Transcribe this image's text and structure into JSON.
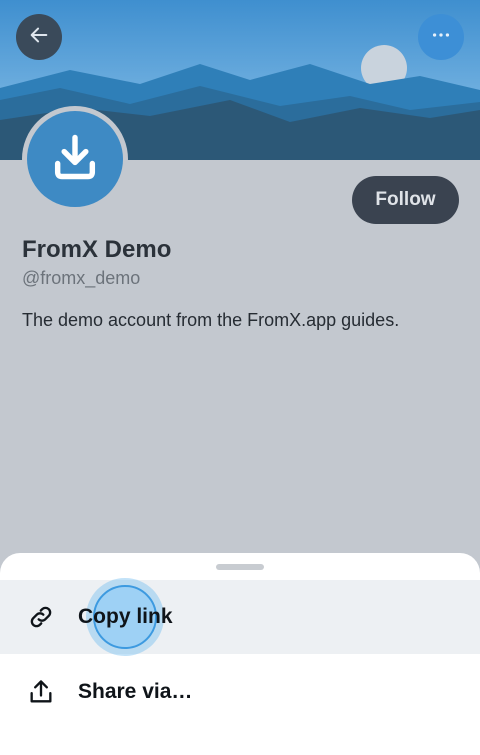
{
  "profile": {
    "name": "FromX Demo",
    "handle": "@fromx_demo",
    "bio": "The demo account from the FromX.app guides.",
    "follow_label": "Follow"
  },
  "header": {
    "back_icon": "arrow-left-icon",
    "more_icon": "more-horizontal-icon"
  },
  "share_sheet": {
    "items": [
      {
        "label": "Copy link",
        "icon": "link-icon",
        "highlighted": true
      },
      {
        "label": "Share via…",
        "icon": "share-icon",
        "highlighted": false
      }
    ]
  },
  "colors": {
    "banner_sky": "#4d9bd6",
    "accent": "#3d8fd6",
    "follow_bg": "#3a4350",
    "page_bg": "#c3c8cf"
  }
}
